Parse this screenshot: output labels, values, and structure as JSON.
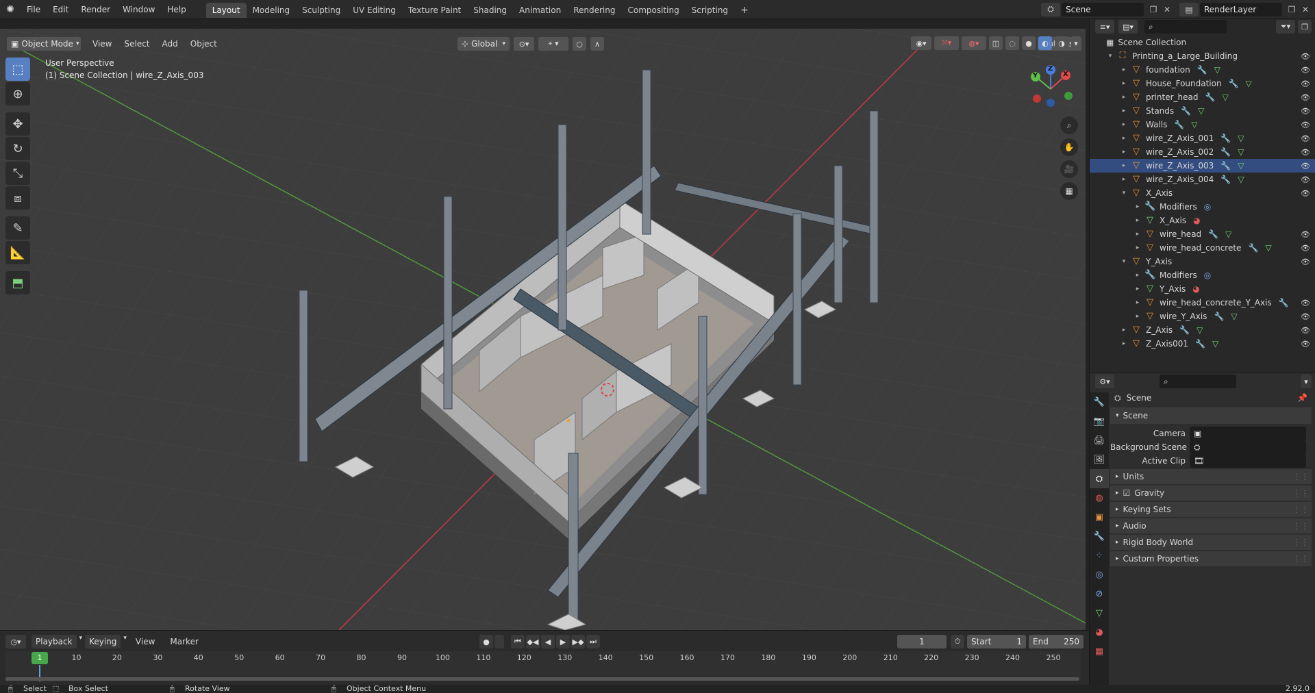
{
  "menu": [
    "File",
    "Edit",
    "Render",
    "Window",
    "Help"
  ],
  "workspaces": [
    "Layout",
    "Modeling",
    "Sculpting",
    "UV Editing",
    "Texture Paint",
    "Shading",
    "Animation",
    "Rendering",
    "Compositing",
    "Scripting"
  ],
  "add_workspace": "+",
  "scene_field": "Scene",
  "render_layer_field": "RenderLayer",
  "viewport": {
    "mode": "Object Mode",
    "menus": [
      "View",
      "Select",
      "Add",
      "Object"
    ],
    "orientation": "Global",
    "options": "Options",
    "perspective_label": "User Perspective",
    "collection_label": "(1) Scene Collection | wire_Z_Axis_003",
    "gizmo": {
      "x": "X",
      "y": "Y",
      "z": "Z"
    }
  },
  "outliner": {
    "root": "Scene Collection",
    "items": [
      {
        "label": "Printing_a_Large_Building",
        "depth": 0,
        "expanded": true,
        "type": "collection",
        "icons": []
      },
      {
        "label": "foundation",
        "depth": 1,
        "expanded": false,
        "type": "object",
        "icons": [
          "mod",
          "mesh"
        ]
      },
      {
        "label": "House_Foundation",
        "depth": 1,
        "expanded": false,
        "type": "object",
        "icons": [
          "mod",
          "mesh"
        ]
      },
      {
        "label": "printer_head",
        "depth": 1,
        "expanded": false,
        "type": "object",
        "icons": [
          "mod",
          "mesh"
        ]
      },
      {
        "label": "Stands",
        "depth": 1,
        "expanded": false,
        "type": "object",
        "icons": [
          "mod",
          "mesh"
        ]
      },
      {
        "label": "Walls",
        "depth": 1,
        "expanded": false,
        "type": "object",
        "icons": [
          "mod",
          "mesh"
        ]
      },
      {
        "label": "wire_Z_Axis_001",
        "depth": 1,
        "expanded": false,
        "type": "object",
        "icons": [
          "mod",
          "mesh"
        ]
      },
      {
        "label": "wire_Z_Axis_002",
        "depth": 1,
        "expanded": false,
        "type": "object",
        "icons": [
          "mod",
          "mesh"
        ]
      },
      {
        "label": "wire_Z_Axis_003",
        "depth": 1,
        "expanded": false,
        "type": "object",
        "icons": [
          "mod",
          "mesh"
        ],
        "selected": true
      },
      {
        "label": "wire_Z_Axis_004",
        "depth": 1,
        "expanded": false,
        "type": "object",
        "icons": [
          "mod",
          "mesh"
        ]
      },
      {
        "label": "X_Axis",
        "depth": 1,
        "expanded": true,
        "type": "object",
        "icons": []
      },
      {
        "label": "Modifiers",
        "depth": 2,
        "expanded": false,
        "type": "modifiers",
        "icons": [
          "modlink"
        ]
      },
      {
        "label": "X_Axis",
        "depth": 2,
        "expanded": false,
        "type": "mesh",
        "icons": [
          "mat"
        ]
      },
      {
        "label": "wire_head",
        "depth": 2,
        "expanded": false,
        "type": "object",
        "icons": [
          "mod",
          "mesh"
        ]
      },
      {
        "label": "wire_head_concrete",
        "depth": 2,
        "expanded": false,
        "type": "object",
        "icons": [
          "mod",
          "mesh"
        ]
      },
      {
        "label": "Y_Axis",
        "depth": 1,
        "expanded": true,
        "type": "object",
        "icons": []
      },
      {
        "label": "Modifiers",
        "depth": 2,
        "expanded": false,
        "type": "modifiers",
        "icons": [
          "modlink"
        ]
      },
      {
        "label": "Y_Axis",
        "depth": 2,
        "expanded": false,
        "type": "mesh",
        "icons": [
          "mat"
        ]
      },
      {
        "label": "wire_head_concrete_Y_Axis",
        "depth": 2,
        "expanded": false,
        "type": "object",
        "icons": [
          "mod"
        ]
      },
      {
        "label": "wire_Y_Axis",
        "depth": 2,
        "expanded": false,
        "type": "object",
        "icons": [
          "mod",
          "mesh"
        ]
      },
      {
        "label": "Z_Axis",
        "depth": 1,
        "expanded": false,
        "type": "object",
        "icons": [
          "mod",
          "mesh"
        ]
      },
      {
        "label": "Z_Axis001",
        "depth": 1,
        "expanded": false,
        "type": "object",
        "icons": [
          "mod",
          "mesh"
        ]
      }
    ]
  },
  "properties": {
    "title": "Scene",
    "section": "Scene",
    "fields": [
      {
        "label": "Camera"
      },
      {
        "label": "Background Scene"
      },
      {
        "label": "Active Clip"
      }
    ],
    "subpanels": [
      "Units",
      "Gravity",
      "Keying Sets",
      "Audio",
      "Rigid Body World",
      "Custom Properties"
    ],
    "gravity_checked": true
  },
  "timeline": {
    "menus": [
      "Playback",
      "Keying",
      "View",
      "Marker"
    ],
    "current_frame": "1",
    "start_label": "Start",
    "start": "1",
    "end_label": "End",
    "end": "250",
    "ticks": [
      "1",
      "10",
      "20",
      "30",
      "40",
      "50",
      "60",
      "70",
      "80",
      "90",
      "100",
      "110",
      "120",
      "130",
      "140",
      "150",
      "160",
      "170",
      "180",
      "190",
      "200",
      "210",
      "220",
      "230",
      "240",
      "250"
    ]
  },
  "statusbar": {
    "select": "Select",
    "box_select": "Box Select",
    "rotate": "Rotate View",
    "context": "Object Context Menu",
    "version": "2.92.0"
  },
  "colors": {
    "accent": "#5680c2",
    "object": "#e2933b",
    "modifier": "#7aa7e8",
    "mesh": "#77d277",
    "material": "#e15a5a",
    "axis_x": "#c8383b",
    "axis_y": "#4f9a3a"
  }
}
